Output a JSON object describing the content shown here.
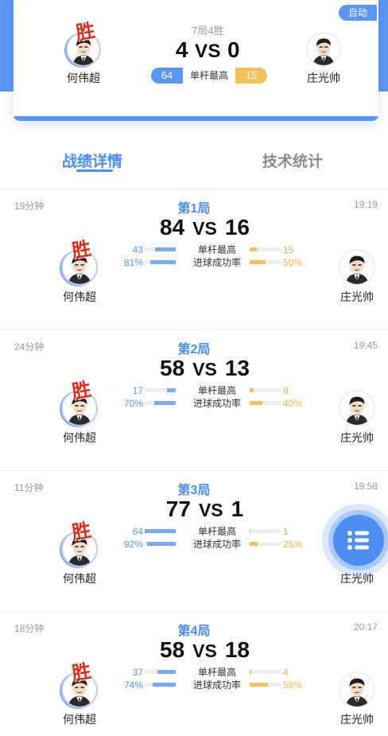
{
  "header": {
    "auto_label": "自动",
    "match_format": "7局4胜",
    "score_left": "4",
    "vs": "VS",
    "score_right": "0",
    "high_break_label": "单杆最高",
    "high_break_left": "64",
    "high_break_right": "15",
    "win_mark": "胜",
    "left_player": "何伟超",
    "right_player": "庄光帅"
  },
  "tabs": [
    {
      "label": "战绩详情",
      "active": true
    },
    {
      "label": "技术统计",
      "active": false
    }
  ],
  "stat_labels": {
    "high_break": "单杆最高",
    "pot_rate": "进球成功率"
  },
  "games": [
    {
      "title": "第1局",
      "duration": "19分钟",
      "time": "19:19",
      "score_left": "84",
      "vs": "VS",
      "score_right": "16",
      "high_break_left": "43",
      "high_break_right": "15",
      "pot_rate_left": "81%",
      "pot_rate_right": "50%",
      "winner": "left",
      "win_mark": "胜",
      "left_player": "何伟超",
      "right_player": "庄光帅"
    },
    {
      "title": "第2局",
      "duration": "24分钟",
      "time": "19:45",
      "score_left": "58",
      "vs": "VS",
      "score_right": "13",
      "high_break_left": "17",
      "high_break_right": "9",
      "pot_rate_left": "70%",
      "pot_rate_right": "40%",
      "winner": "left",
      "win_mark": "胜",
      "left_player": "何伟超",
      "right_player": "庄光帅"
    },
    {
      "title": "第3局",
      "duration": "11分钟",
      "time": "19:58",
      "score_left": "77",
      "vs": "VS",
      "score_right": "1",
      "high_break_left": "64",
      "high_break_right": "1",
      "pot_rate_left": "92%",
      "pot_rate_right": "25%",
      "winner": "left",
      "win_mark": "胜",
      "left_player": "何伟超",
      "right_player": "庄光帅"
    },
    {
      "title": "第4局",
      "duration": "18分钟",
      "time": "20:17",
      "score_left": "58",
      "vs": "VS",
      "score_right": "18",
      "high_break_left": "37",
      "high_break_right": "4",
      "pot_rate_left": "74%",
      "pot_rate_right": "58%",
      "winner": "left",
      "win_mark": "胜",
      "left_player": "何伟超",
      "right_player": "庄光帅"
    }
  ],
  "bar_fractions": {
    "high_break_left": [
      0.67,
      0.27,
      1.0,
      0.58
    ],
    "high_break_right": [
      0.23,
      0.14,
      0.02,
      0.06
    ],
    "pot_rate_left": [
      0.81,
      0.7,
      0.92,
      0.74
    ],
    "pot_rate_right": [
      0.5,
      0.4,
      0.25,
      0.58
    ]
  },
  "fab": {
    "icon": "list-icon"
  },
  "colors": {
    "primary": "#4d8ef2",
    "accent_orange": "#f4c15b",
    "win_red": "#d8301c"
  }
}
